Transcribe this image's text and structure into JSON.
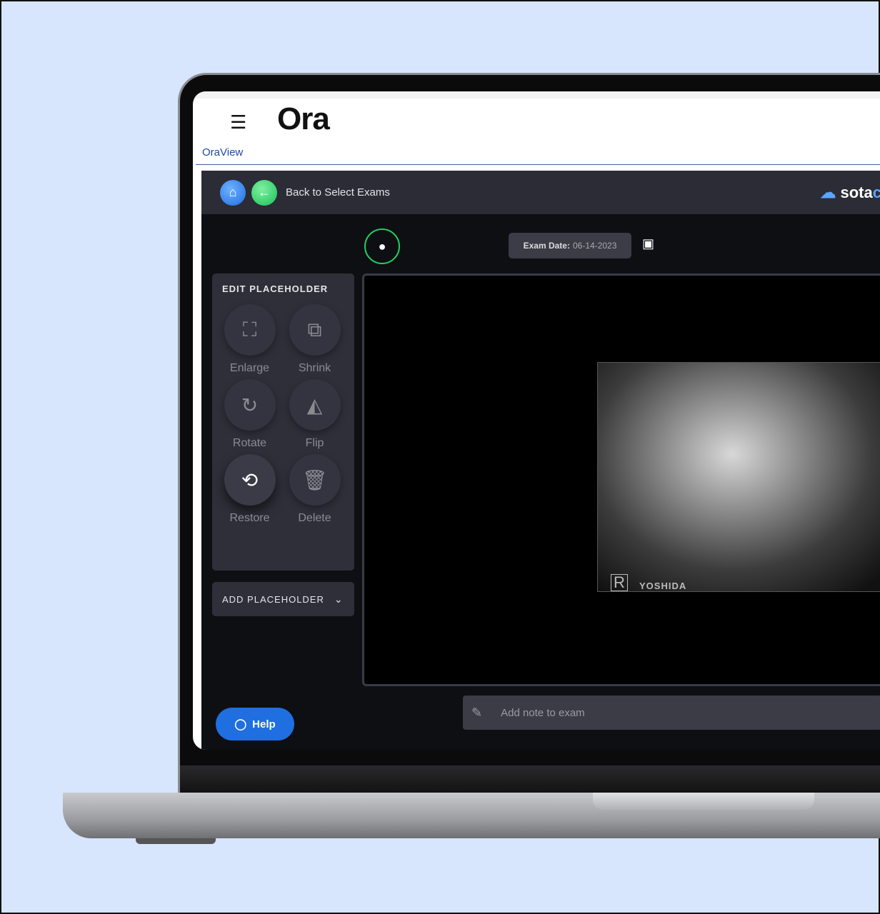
{
  "header": {
    "app_logo": "Ora",
    "section": "OraView"
  },
  "toolbar": {
    "back_label": "Back to Select Exams",
    "brand": "sota",
    "brand_cut": "c"
  },
  "exam": {
    "date_label": "Exam Date:",
    "date_value": "06-14-2023"
  },
  "edit_panel": {
    "title": "EDIT PLACEHOLDER",
    "tools": [
      {
        "label": "Enlarge",
        "icon": "⛶"
      },
      {
        "label": "Shrink",
        "icon": "⧉"
      },
      {
        "label": "Rotate",
        "icon": "↻"
      },
      {
        "label": "Flip",
        "icon": "◭"
      },
      {
        "label": "Restore",
        "icon": "⟲"
      },
      {
        "label": "Delete",
        "icon": "🗑"
      }
    ]
  },
  "add_panel": {
    "title": "ADD PLACEHOLDER"
  },
  "image": {
    "marker": "R",
    "brand": "YOSHIDA"
  },
  "note": {
    "placeholder": "Add note to exam"
  },
  "help": {
    "label": "Help"
  }
}
